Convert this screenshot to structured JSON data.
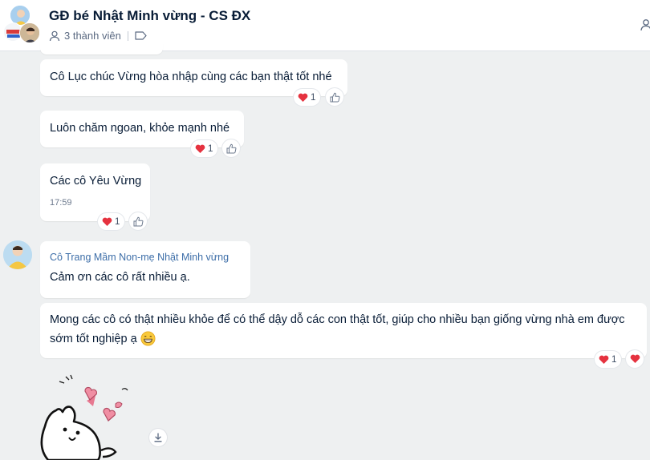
{
  "header": {
    "title": "GĐ bé Nhật Minh vừng - CS ĐX",
    "members": "3 thành viên"
  },
  "messages": [
    {
      "text": "Cô Lục chúc Vừng hòa nhập cùng các bạn thật tốt nhé",
      "reaction_count": "1"
    },
    {
      "text": "Luôn chăm ngoan,  khỏe mạnh nhé",
      "reaction_count": "1"
    },
    {
      "text": "Các cô Yêu Vừng",
      "time": "17:59",
      "reaction_count": "1"
    },
    {
      "sender": "Cô Trang Mầm Non-mẹ Nhật Minh vừng",
      "text": "Cảm ơn các cô rất nhiều ạ."
    },
    {
      "text_line1": "Mong các cô có thật nhiều khỏe để có thể dậy dỗ các con thật tốt, giúp cho nhiều bạn giống vừng nhà em được",
      "text_line2": "sớm tốt nghiệp ạ",
      "reaction_count": "1"
    }
  ],
  "icons": {
    "heart": "heart-icon",
    "like": "thumbs-up-icon",
    "grin": "grinning-emoji-icon",
    "download": "download-icon",
    "person": "person-icon",
    "tag": "tag-icon"
  },
  "colors": {
    "heart": "#e5323f",
    "accent": "#3d6ea8"
  }
}
